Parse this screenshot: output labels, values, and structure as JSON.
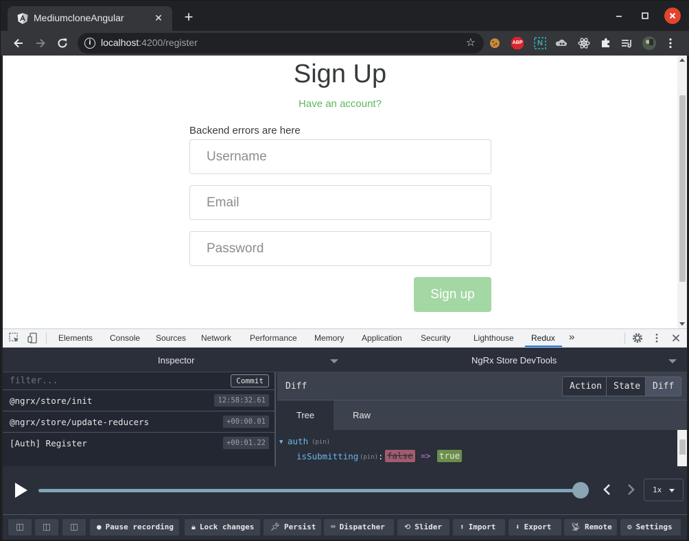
{
  "browser": {
    "tab_title": "MediumcloneAngular",
    "tab_close": "✕",
    "new_tab": "+",
    "url_host": "localhost",
    "url_path": ":4200/register",
    "extensions": [
      "cookie-icon",
      "abp-icon",
      "n-icon",
      "cloud-icon",
      "react-icon",
      "puzzle-icon",
      "media-queue-icon",
      "avatar"
    ],
    "abp_label": "ABP",
    "n_label": "N"
  },
  "page": {
    "title": "Sign Up",
    "have_account": "Have an account?",
    "backend_errors": "Backend errors are here",
    "username_placeholder": "Username",
    "email_placeholder": "Email",
    "password_placeholder": "Password",
    "submit_label": "Sign up",
    "accent_color": "#5cb85c"
  },
  "devtools": {
    "tabs": [
      "Elements",
      "Console",
      "Sources",
      "Network",
      "Performance",
      "Memory",
      "Application",
      "Security",
      "Lighthouse",
      "Redux"
    ],
    "active_tab": "Redux",
    "more": "»"
  },
  "redux": {
    "left_header": "Inspector",
    "right_header": "NgRx Store DevTools",
    "filter_placeholder": "filter...",
    "commit_label": "Commit",
    "actions": [
      {
        "name": "@ngrx/store/init",
        "time": "12:58:32.61"
      },
      {
        "name": "@ngrx/store/update-reducers",
        "time": "+00:00.01"
      },
      {
        "name": "[Auth] Register",
        "time": "+00:01.22"
      }
    ],
    "panel_title": "Diff",
    "segments": [
      "Action",
      "State",
      "Diff"
    ],
    "selected_segment": "Diff",
    "view_tabs": [
      "Tree",
      "Raw"
    ],
    "selected_view": "Tree",
    "tree": {
      "root_key": "auth",
      "root_pin": "(pin)",
      "child_key": "isSubmitting",
      "child_pin": "(pin)",
      "colon": ":",
      "old_value": "false",
      "arrow": "=>",
      "new_value": "true"
    },
    "speed": "1x",
    "bottom_buttons": [
      {
        "label": "Pause recording",
        "icon": "pause-circle-icon"
      },
      {
        "label": "Lock changes",
        "icon": "lock-icon"
      },
      {
        "label": "Persist",
        "icon": "pin-icon"
      },
      {
        "label": "Dispatcher",
        "icon": "keyboard-icon"
      },
      {
        "label": "Slider",
        "icon": "history-icon"
      },
      {
        "label": "Import",
        "icon": "import-icon"
      },
      {
        "label": "Export",
        "icon": "export-icon"
      },
      {
        "label": "Remote",
        "icon": "remote-icon"
      },
      {
        "label": "Settings",
        "icon": "gear-icon"
      }
    ]
  }
}
